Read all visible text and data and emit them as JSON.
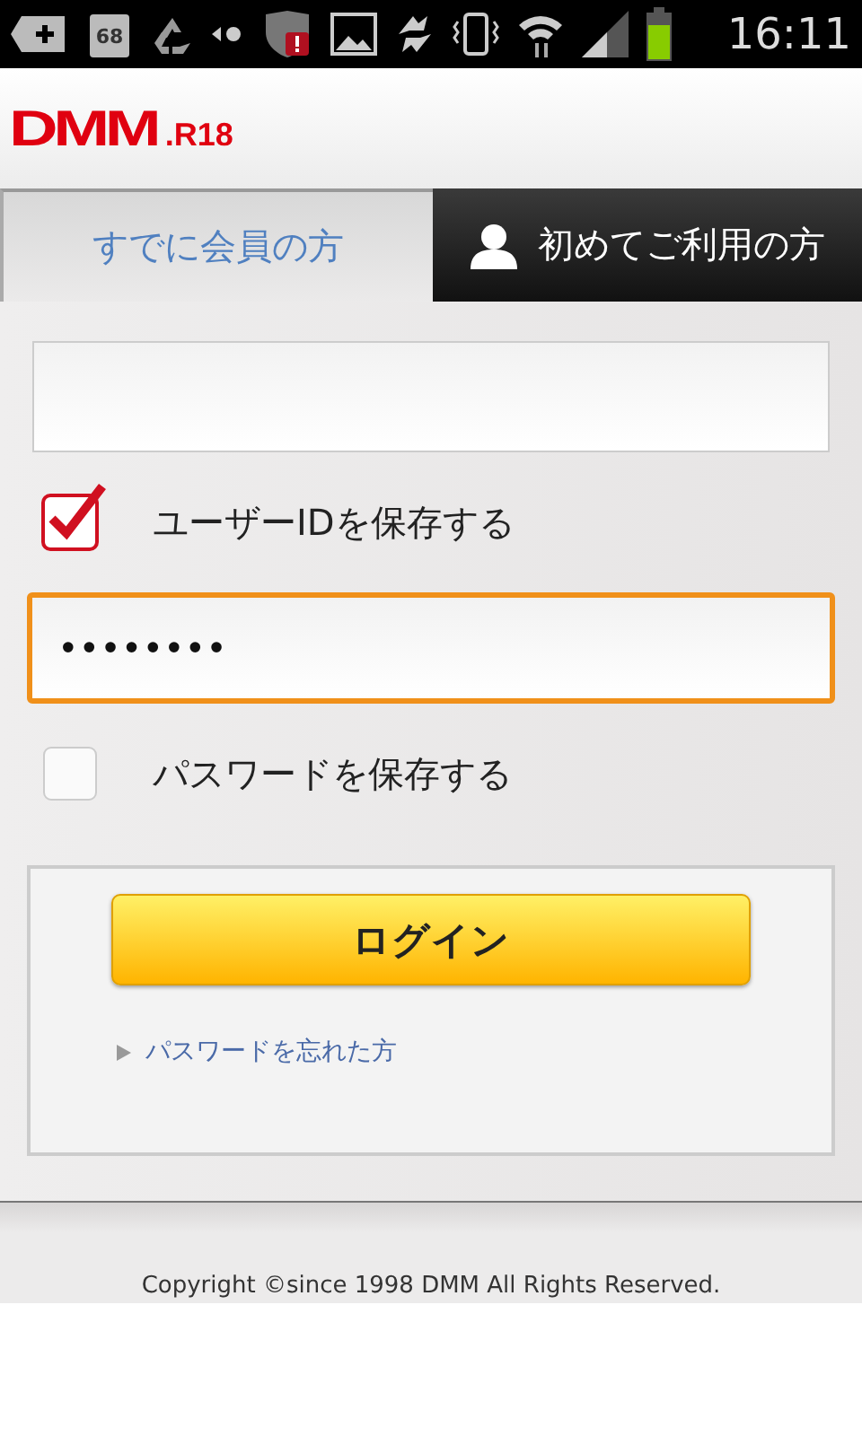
{
  "status_bar": {
    "calendar_day": "68",
    "time": "16:11"
  },
  "header": {
    "logo": "DMM",
    "logo_suffix": ".R18"
  },
  "tabs": [
    {
      "label": "すでに会員の方",
      "selected": true,
      "kind": "plain"
    },
    {
      "label": "初めてご利用の方",
      "selected": false,
      "kind": "person"
    }
  ],
  "form": {
    "user_id": {
      "focused": false
    },
    "save_id": {
      "label": "ユーザーIDを保存する",
      "checked": true
    },
    "password": {
      "value": "••••••••",
      "focused": true
    },
    "save_password": {
      "label": "パスワードを保存する",
      "checked": false
    },
    "login_button": "ログイン",
    "forgot_link": "パスワードを忘れた方"
  },
  "footer": {
    "copyright": "Copyright ©since 1998 DMM All Rights Reserved."
  }
}
